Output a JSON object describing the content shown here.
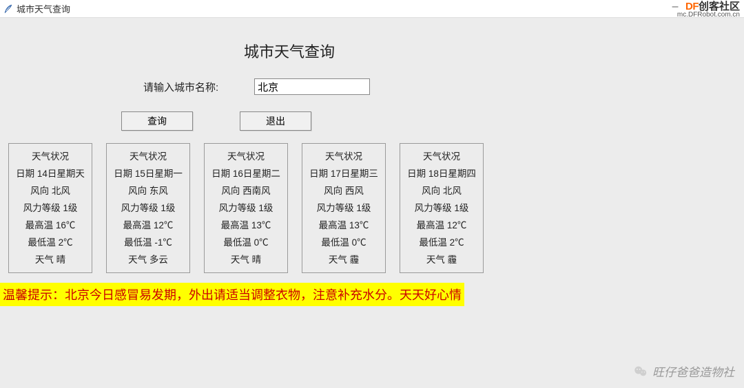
{
  "window": {
    "title": "城市天气查询",
    "brand_df": "DF",
    "brand_cn": "创客社区",
    "brand_url": "mc.DFRobot.com.cn"
  },
  "heading": "城市天气查询",
  "form": {
    "input_label": "请输入城市名称:",
    "input_value": "北京",
    "query_btn": "查询",
    "exit_btn": "退出"
  },
  "card_field_labels": {
    "status": "天气状况",
    "date": "日期",
    "wind_dir": "风向",
    "wind_level": "风力等级",
    "high": "最高温",
    "low": "最低温",
    "weather": "天气"
  },
  "cards": [
    {
      "date": "14日星期天",
      "wind_dir": "北风",
      "wind_level": "1级",
      "high": "16℃",
      "low": "2℃",
      "weather": "晴"
    },
    {
      "date": "15日星期一",
      "wind_dir": "东风",
      "wind_level": "1级",
      "high": "12℃",
      "low": "-1℃",
      "weather": "多云"
    },
    {
      "date": "16日星期二",
      "wind_dir": "西南风",
      "wind_level": "1级",
      "high": "13℃",
      "low": "0℃",
      "weather": "晴"
    },
    {
      "date": "17日星期三",
      "wind_dir": "西风",
      "wind_level": "1级",
      "high": "13℃",
      "low": "0℃",
      "weather": "霾"
    },
    {
      "date": "18日星期四",
      "wind_dir": "北风",
      "wind_level": "1级",
      "high": "12℃",
      "low": "2℃",
      "weather": "霾"
    }
  ],
  "tip": "温馨提示：北京今日感冒易发期，外出请适当调整衣物，注意补充水分。天天好心情",
  "watermark": "旺仔爸爸造物社"
}
